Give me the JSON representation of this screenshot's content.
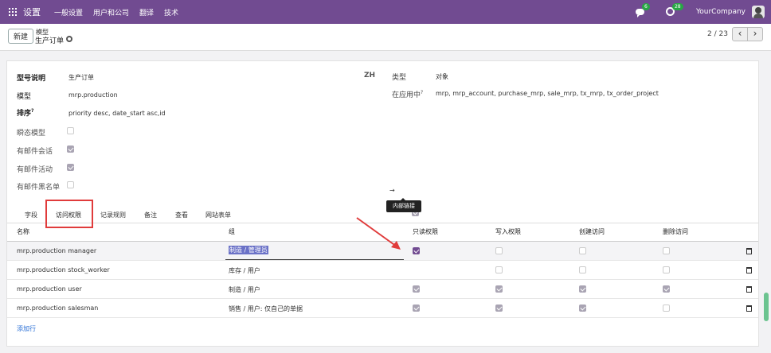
{
  "navbar": {
    "brand": "设置",
    "menu": [
      "一般设置",
      "用户和公司",
      "翻译",
      "技术"
    ],
    "chat_badge": "6",
    "activity_badge": "28",
    "company": "YourCompany"
  },
  "control": {
    "new_button": "新建",
    "breadcrumb_parent": "模型",
    "breadcrumb_current": "生产订单",
    "pager": "2 / 23",
    "prev": "‹",
    "next": "›"
  },
  "form": {
    "desc_label": "型号说明",
    "desc_value": "生产订单",
    "lang": "ZH",
    "type_label": "类型",
    "type_value": "对象",
    "model_label": "模型",
    "model_value": "mrp.production",
    "inapp_label": "在应用中",
    "inapp_value": "mrp, mrp_account, purchase_mrp, sale_mrp, tx_mrp, tx_order_project",
    "order_label": "排序",
    "order_value": "priority desc, date_start asc,id",
    "transient_label": "瞬态模型",
    "mail_thread_label": "有邮件会话",
    "mail_activity_label": "有邮件活动",
    "mail_blacklist_label": "有邮件黑名单",
    "sup_mark": "?"
  },
  "tabs": [
    "字段",
    "访问权限",
    "记录规则",
    "备注",
    "查看",
    "网站表单"
  ],
  "table": {
    "headers": [
      "名称",
      "组",
      "只读权限",
      "写入权限",
      "创建访问",
      "删除访问"
    ],
    "rows": [
      {
        "name": "mrp.production manager",
        "group": "制造 / 管理员",
        "read": true,
        "write": false,
        "create": false,
        "unlink": false
      },
      {
        "name": "mrp.production stock_worker",
        "group": "库存 / 用户",
        "read": true,
        "write": false,
        "create": false,
        "unlink": false
      },
      {
        "name": "mrp.production user",
        "group": "制造 / 用户",
        "read": true,
        "write": true,
        "create": true,
        "unlink": true
      },
      {
        "name": "mrp.production salesman",
        "group": "销售 / 用户: 仅自己的单据",
        "read": true,
        "write": true,
        "create": true,
        "unlink": false
      }
    ],
    "add_row": "添加行"
  },
  "tooltip": "内部链接",
  "ext_link": "→",
  "colors": {
    "navbar": "#714b91",
    "highlight": "#e03b3b",
    "selection": "#6b72c7"
  }
}
